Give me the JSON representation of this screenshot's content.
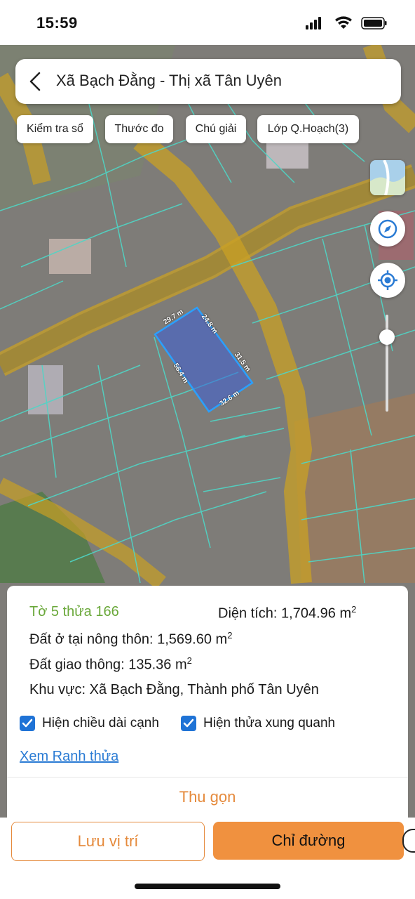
{
  "status_bar": {
    "time": "15:59"
  },
  "header": {
    "title": "Xã Bạch Đằng - Thị xã Tân Uyên"
  },
  "toolbar": {
    "check_book": "Kiểm tra sổ",
    "ruler": "Thước đo",
    "legend": "Chú giải",
    "planning_layer": "Lớp Q.Hoạch(3)"
  },
  "parcel_measurements": {
    "top": "29.7 m",
    "top_right": "24.8 m",
    "right": "31.5 m",
    "bottom": "32.6 m",
    "left": "56.4 m"
  },
  "colors": {
    "accent": "#f0913f",
    "link": "#2a7bd4",
    "checkbox": "#1f73d6",
    "parcel_id": "#6aa83a",
    "boundary": "#4fd6c6",
    "road": "#c9a024",
    "selected_parcel": "#3a5fd9"
  },
  "info": {
    "parcel_id": "Tờ 5 thửa 166",
    "area_label": "Diện tích: 1,704.96 m",
    "area_sup": "2",
    "residential_label": "Đất ở tại nông thôn: 1,569.60 m",
    "residential_sup": "2",
    "traffic_label": "Đất giao thông: 135.36 m",
    "traffic_sup": "2",
    "region": "Khu vực: Xã Bạch Đằng, Thành phố Tân Uyên",
    "show_edge_length": "Hiện chiều dài cạnh",
    "show_surrounding": "Hiện thửa xung quanh",
    "view_boundary": "Xem Ranh thửa",
    "collapse": "Thu gọn"
  },
  "actions": {
    "save_location": "Lưu vị trí",
    "directions": "Chỉ đường"
  }
}
